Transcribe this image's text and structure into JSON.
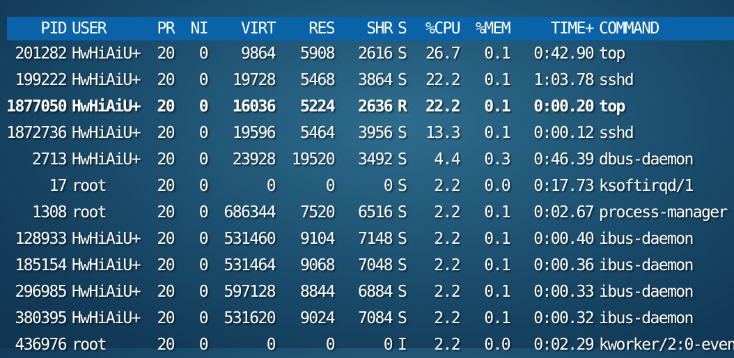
{
  "columns": {
    "pid": "PID",
    "user": "USER",
    "pr": "PR",
    "ni": "NI",
    "virt": "VIRT",
    "res": "RES",
    "shr": "SHR",
    "s": "S",
    "cpu": "%CPU",
    "mem": "%MEM",
    "time": "TIME+",
    "command": "COMMAND"
  },
  "processes": [
    {
      "pid": "201282",
      "user": "HwHiAiU+",
      "pr": "20",
      "ni": "0",
      "virt": "9864",
      "res": "5908",
      "shr": "2616",
      "s": "S",
      "cpu": "26.7",
      "mem": "0.1",
      "time": "0:42.90",
      "command": "top"
    },
    {
      "pid": "199222",
      "user": "HwHiAiU+",
      "pr": "20",
      "ni": "0",
      "virt": "19728",
      "res": "5468",
      "shr": "3864",
      "s": "S",
      "cpu": "22.2",
      "mem": "0.1",
      "time": "1:03.78",
      "command": "sshd"
    },
    {
      "pid": "1877050",
      "user": "HwHiAiU+",
      "pr": "20",
      "ni": "0",
      "virt": "16036",
      "res": "5224",
      "shr": "2636",
      "s": "R",
      "cpu": "22.2",
      "mem": "0.1",
      "time": "0:00.20",
      "command": "top"
    },
    {
      "pid": "1872736",
      "user": "HwHiAiU+",
      "pr": "20",
      "ni": "0",
      "virt": "19596",
      "res": "5464",
      "shr": "3956",
      "s": "S",
      "cpu": "13.3",
      "mem": "0.1",
      "time": "0:00.12",
      "command": "sshd"
    },
    {
      "pid": "2713",
      "user": "HwHiAiU+",
      "pr": "20",
      "ni": "0",
      "virt": "23928",
      "res": "19520",
      "shr": "3492",
      "s": "S",
      "cpu": "4.4",
      "mem": "0.3",
      "time": "0:46.39",
      "command": "dbus-daemon"
    },
    {
      "pid": "17",
      "user": "root",
      "pr": "20",
      "ni": "0",
      "virt": "0",
      "res": "0",
      "shr": "0",
      "s": "S",
      "cpu": "2.2",
      "mem": "0.0",
      "time": "0:17.73",
      "command": "ksoftirqd/1"
    },
    {
      "pid": "1308",
      "user": "root",
      "pr": "20",
      "ni": "0",
      "virt": "686344",
      "res": "7520",
      "shr": "6516",
      "s": "S",
      "cpu": "2.2",
      "mem": "0.1",
      "time": "0:02.67",
      "command": "process-manager"
    },
    {
      "pid": "128933",
      "user": "HwHiAiU+",
      "pr": "20",
      "ni": "0",
      "virt": "531460",
      "res": "9104",
      "shr": "7148",
      "s": "S",
      "cpu": "2.2",
      "mem": "0.1",
      "time": "0:00.40",
      "command": "ibus-daemon"
    },
    {
      "pid": "185154",
      "user": "HwHiAiU+",
      "pr": "20",
      "ni": "0",
      "virt": "531464",
      "res": "9068",
      "shr": "7048",
      "s": "S",
      "cpu": "2.2",
      "mem": "0.1",
      "time": "0:00.36",
      "command": "ibus-daemon"
    },
    {
      "pid": "296985",
      "user": "HwHiAiU+",
      "pr": "20",
      "ni": "0",
      "virt": "597128",
      "res": "8844",
      "shr": "6884",
      "s": "S",
      "cpu": "2.2",
      "mem": "0.1",
      "time": "0:00.33",
      "command": "ibus-daemon"
    },
    {
      "pid": "380395",
      "user": "HwHiAiU+",
      "pr": "20",
      "ni": "0",
      "virt": "531620",
      "res": "9024",
      "shr": "7084",
      "s": "S",
      "cpu": "2.2",
      "mem": "0.1",
      "time": "0:00.32",
      "command": "ibus-daemon"
    },
    {
      "pid": "436976",
      "user": "root",
      "pr": "20",
      "ni": "0",
      "virt": "0",
      "res": "0",
      "shr": "0",
      "s": "I",
      "cpu": "2.2",
      "mem": "0.0",
      "time": "0:02.29",
      "command": "kworker/2:0-even"
    }
  ],
  "highlight_row_pid": "1877050",
  "colors": {
    "header_bar": "#0a62a8",
    "text": "#ffffff"
  }
}
